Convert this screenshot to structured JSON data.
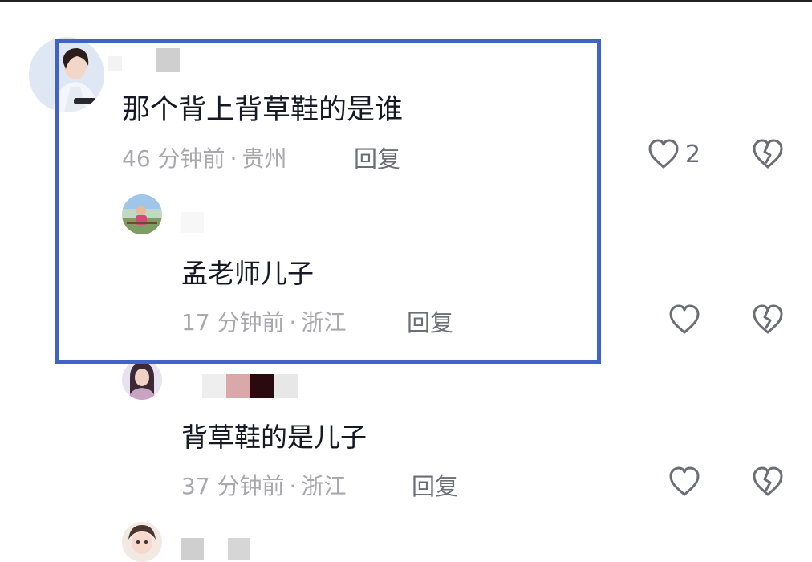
{
  "colors": {
    "highlight_border": "#3f63c6",
    "text_primary": "#161823",
    "text_meta": "#a8a8ad",
    "icon_gray": "#6b6e76"
  },
  "comments": [
    {
      "avatar_icon": "woman-portrait-avatar",
      "text": "那个背上背草鞋的是谁",
      "time": "46 分钟前",
      "location": "贵州",
      "dot": "·",
      "reply_label": "回复",
      "like_count": "2"
    },
    {
      "avatar_icon": "child-photo-avatar",
      "text": "孟老师儿子",
      "time": "17 分钟前",
      "location": "浙江",
      "dot": "·",
      "reply_label": "回复"
    },
    {
      "avatar_icon": "girl-portrait-avatar",
      "text": "背草鞋的是儿子",
      "time": "37 分钟前",
      "location": "浙江",
      "dot": "·",
      "reply_label": "回复"
    },
    {
      "avatar_icon": "baby-photo-avatar"
    }
  ]
}
